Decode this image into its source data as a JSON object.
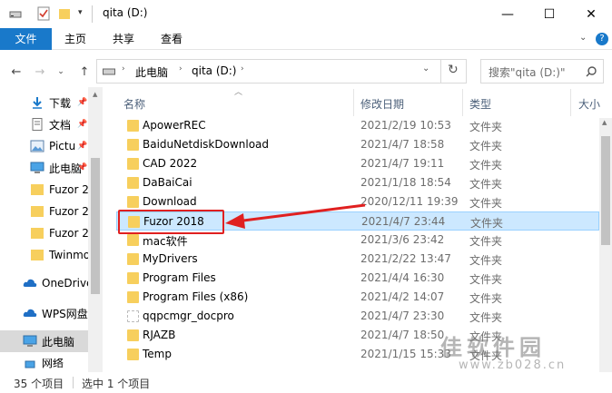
{
  "window": {
    "title": "qita (D:)",
    "minimize_glyph": "—",
    "maximize_glyph": "☐",
    "close_glyph": "✕"
  },
  "ribbon": {
    "tabs": [
      "文件",
      "主页",
      "共享",
      "查看"
    ],
    "help_glyph": "?"
  },
  "address": {
    "crumbs": [
      "此电脑",
      "qita (D:)"
    ],
    "search_placeholder": "搜索\"qita (D:)\""
  },
  "nav": {
    "items": [
      {
        "label": "下载",
        "icon": "download-icon",
        "pinned": true
      },
      {
        "label": "文档",
        "icon": "document-icon",
        "pinned": true
      },
      {
        "label": "Pictu",
        "icon": "pictures-icon",
        "pinned": true
      },
      {
        "label": "此电脑",
        "icon": "computer-icon",
        "pinned": true
      },
      {
        "label": "Fuzor 2",
        "icon": "folder-icon",
        "pinned": false
      },
      {
        "label": "Fuzor 2",
        "icon": "folder-icon",
        "pinned": false
      },
      {
        "label": "Fuzor 2",
        "icon": "folder-icon",
        "pinned": false
      },
      {
        "label": "Twinmo",
        "icon": "folder-icon",
        "pinned": false
      },
      {
        "label": "OneDrive",
        "icon": "cloud-icon",
        "pinned": false
      },
      {
        "label": "WPS网盘",
        "icon": "cloud-icon",
        "pinned": false
      },
      {
        "label": "此电脑",
        "icon": "computer-icon",
        "pinned": false
      },
      {
        "label": "网络",
        "icon": "network-icon",
        "pinned": false
      }
    ]
  },
  "columns": {
    "name": "名称",
    "date": "修改日期",
    "type": "类型",
    "size": "大小"
  },
  "files": [
    {
      "name": "ApowerREC",
      "date": "2021/2/19 10:53",
      "type": "文件夹"
    },
    {
      "name": "BaiduNetdiskDownload",
      "date": "2021/4/7 18:58",
      "type": "文件夹"
    },
    {
      "name": "CAD 2022",
      "date": "2021/4/7 19:11",
      "type": "文件夹"
    },
    {
      "name": "DaBaiCai",
      "date": "2021/1/18 18:54",
      "type": "文件夹"
    },
    {
      "name": "Download",
      "date": "2020/12/11 19:39",
      "type": "文件夹"
    },
    {
      "name": "Fuzor 2018",
      "date": "2021/4/7 23:44",
      "type": "文件夹",
      "selected": true
    },
    {
      "name": "mac软件",
      "date": "2021/3/6 23:42",
      "type": "文件夹"
    },
    {
      "name": "MyDrivers",
      "date": "2021/2/22 13:47",
      "type": "文件夹"
    },
    {
      "name": "Program Files",
      "date": "2021/4/4 16:30",
      "type": "文件夹"
    },
    {
      "name": "Program Files (x86)",
      "date": "2021/4/2 14:07",
      "type": "文件夹"
    },
    {
      "name": "qqpcmgr_docpro",
      "date": "2021/4/7 23:30",
      "type": "文件夹"
    },
    {
      "name": "RJAZB",
      "date": "2021/4/7 18:50",
      "type": "文件夹"
    },
    {
      "name": "Temp",
      "date": "2021/1/15 15:33",
      "type": "文件夹"
    }
  ],
  "status": {
    "count": "35 个项目",
    "selection": "选中 1 个项目"
  },
  "watermark": {
    "line1": "佳软件园",
    "line2": "www.zb028.cn"
  },
  "colors": {
    "accent": "#1979ca",
    "selection": "#cce8ff",
    "annotation": "#e02020"
  }
}
